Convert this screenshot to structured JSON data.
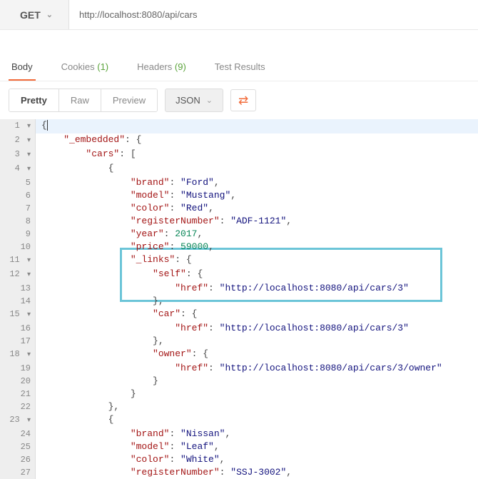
{
  "request": {
    "method": "GET",
    "url": "http://localhost:8080/api/cars"
  },
  "tabs": {
    "body": "Body",
    "cookies": "Cookies",
    "cookies_count": "(1)",
    "headers": "Headers",
    "headers_count": "(9)",
    "test_results": "Test Results"
  },
  "view": {
    "pretty": "Pretty",
    "raw": "Raw",
    "preview": "Preview",
    "format": "JSON"
  },
  "json": {
    "k_embedded": "\"_embedded\"",
    "k_cars": "\"cars\"",
    "k_brand": "\"brand\"",
    "k_model": "\"model\"",
    "k_color": "\"color\"",
    "k_registerNumber": "\"registerNumber\"",
    "k_year": "\"year\"",
    "k_price": "\"price\"",
    "k_links": "\"_links\"",
    "k_self": "\"self\"",
    "k_href": "\"href\"",
    "k_car": "\"car\"",
    "k_owner": "\"owner\"",
    "v_ford": "\"Ford\"",
    "v_mustang": "\"Mustang\"",
    "v_red": "\"Red\"",
    "v_adf": "\"ADF-1121\"",
    "v_year1": "2017",
    "v_price1": "59000",
    "v_href_cars3": "\"http://localhost:8080/api/cars/3\"",
    "v_href_owner": "\"http://localhost:8080/api/cars/3/owner\"",
    "v_nissan": "\"Nissan\"",
    "v_leaf": "\"Leaf\"",
    "v_white": "\"White\"",
    "v_ssj": "\"SSJ-3002\""
  }
}
